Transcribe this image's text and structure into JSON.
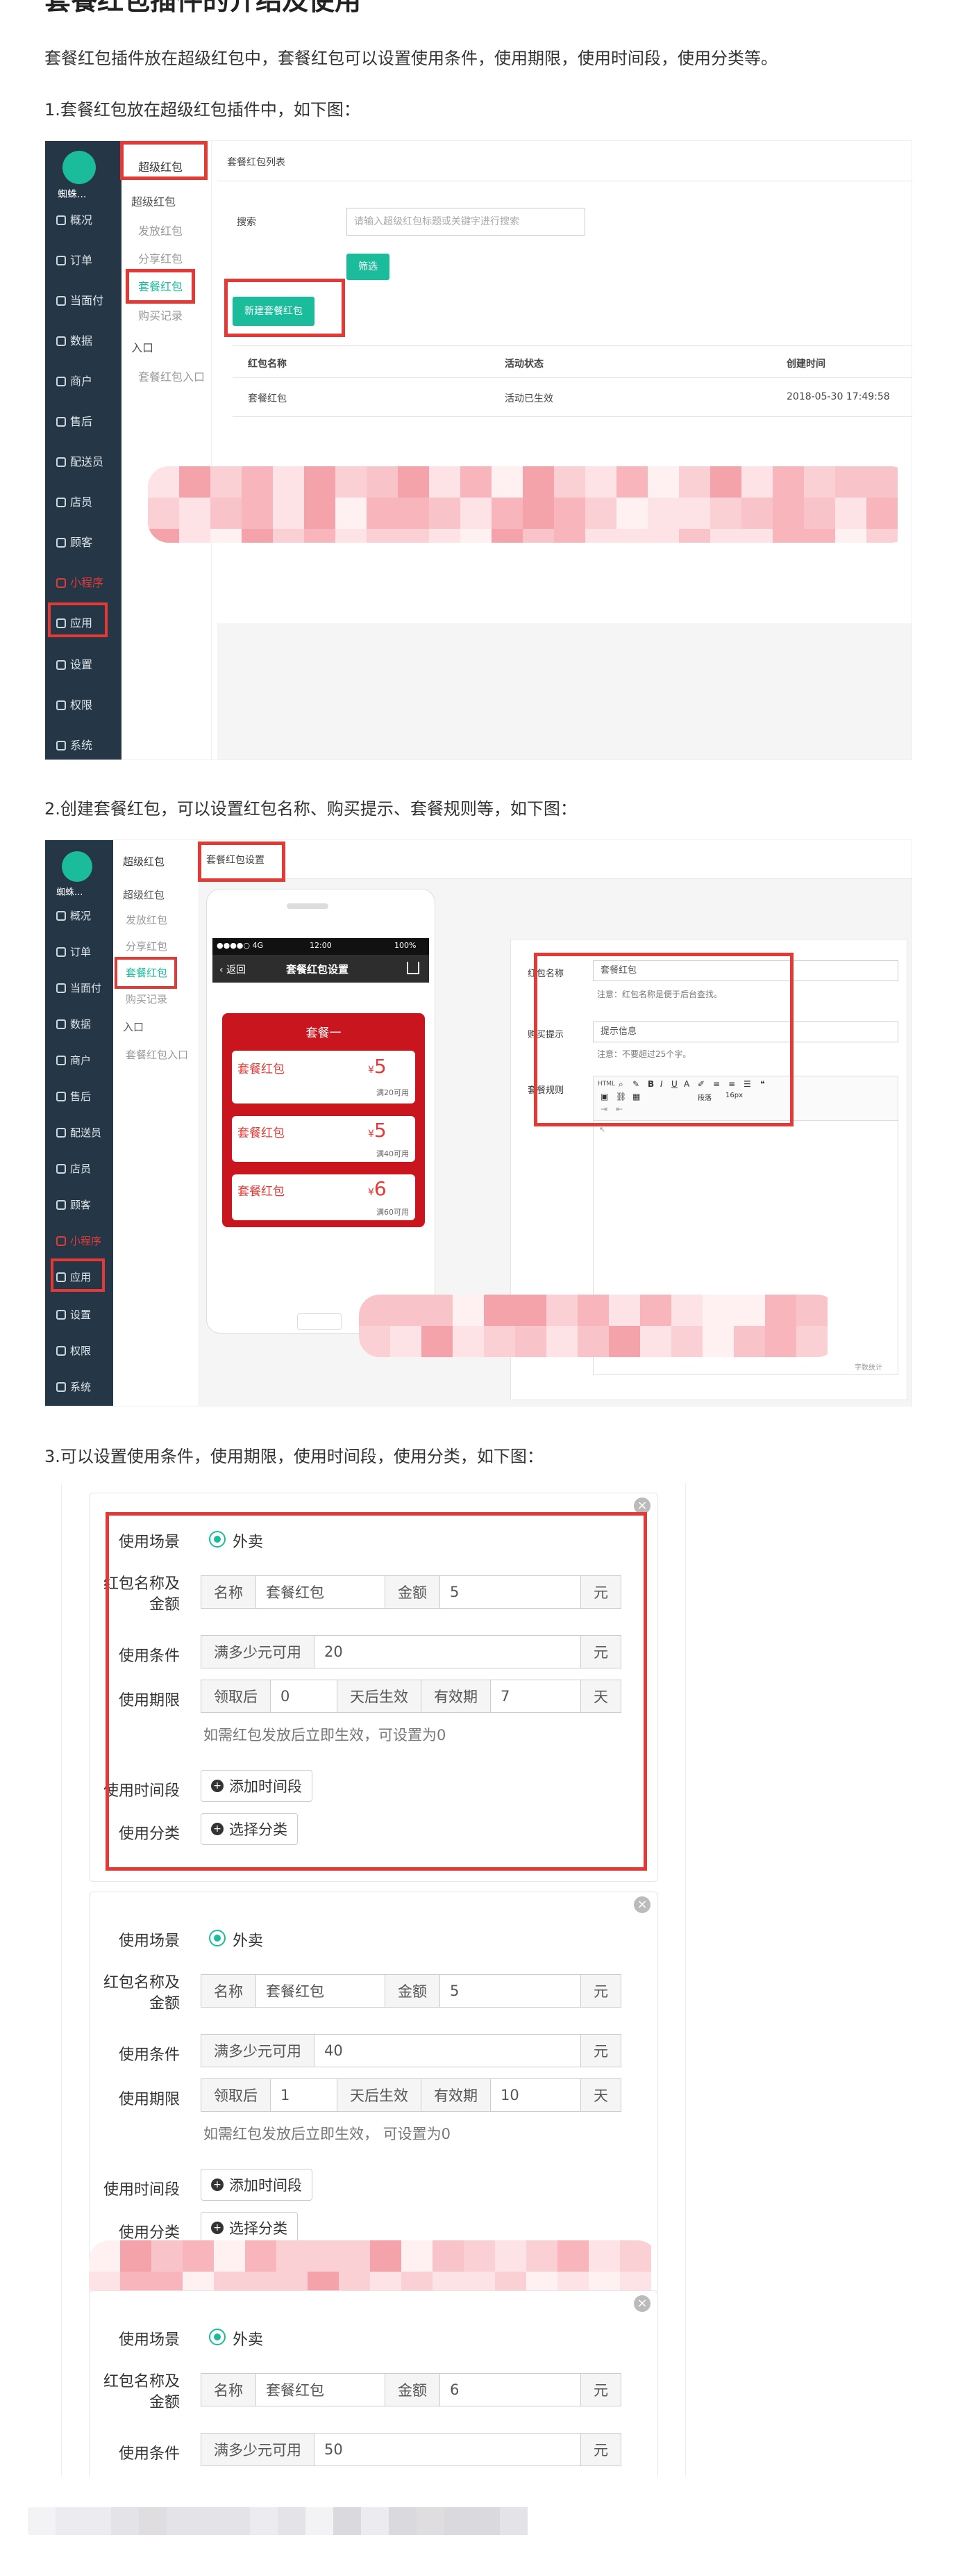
{
  "article": {
    "title": "套餐红包插件的介绍及使用",
    "intro": "套餐红包插件放在超级红包中，套餐红包可以设置使用条件，使用期限，使用时间段，使用分类等。",
    "step1": "1.套餐红包放在超级红包插件中，如下图：",
    "step2": "2.创建套餐红包，可以设置红包名称、购买提示、套餐规则等，如下图：",
    "step3": "3.可以设置使用条件，使用期限，使用时间段，使用分类，如下图："
  },
  "sidebar": {
    "store": "蜘蛛...",
    "items": [
      "概况",
      "订单",
      "当面付",
      "数据",
      "商户",
      "售后",
      "配送员",
      "店员",
      "顾客",
      "小程序",
      "应用",
      "设置",
      "权限",
      "系统"
    ]
  },
  "shot1": {
    "submenu": {
      "title": "超级红包",
      "group": "超级红包",
      "items": [
        "发放红包",
        "分享红包",
        "套餐红包",
        "购买记录"
      ],
      "group2": "入口",
      "entry": "套餐红包入口"
    },
    "header": "套餐红包列表",
    "search_label": "搜索",
    "search_placeholder": "请输入超级红包标题或关键字进行搜索",
    "filter_btn": "筛选",
    "new_btn": "新建套餐红包",
    "table": {
      "headers": [
        "红包名称",
        "活动状态",
        "创建时间"
      ],
      "row": [
        "套餐红包",
        "活动已生效",
        "2018-05-30 17:49:58"
      ]
    }
  },
  "shot2": {
    "header": "套餐红包设置",
    "submenu": {
      "title": "超级红包",
      "group": "超级红包",
      "items": [
        "发放红包",
        "分享红包",
        "套餐红包",
        "购买记录"
      ],
      "group2": "入口",
      "entry": "套餐红包入口"
    },
    "phone": {
      "status_left": "●●●●○ 4G",
      "status_time": "12:00",
      "status_right": "100%",
      "back": "返回",
      "title": "套餐红包设置",
      "package": "套餐一",
      "coupons": [
        {
          "name": "套餐红包",
          "amount": "5",
          "cond": "满20可用"
        },
        {
          "name": "套餐红包",
          "amount": "5",
          "cond": "满40可用"
        },
        {
          "name": "套餐红包",
          "amount": "6",
          "cond": "满60可用"
        }
      ]
    },
    "form": {
      "name_label": "红包名称",
      "name_value": "套餐红包",
      "name_note": "注意：红包名称是便于后台查找。",
      "tip_label": "购买提示",
      "tip_value": "提示信息",
      "tip_note": "注意：不要超过25个字。",
      "rule_label": "套餐规则",
      "count": "字数统计"
    },
    "editor": {
      "src": "HTML",
      "para": "段落",
      "size": "16px"
    }
  },
  "shot3": {
    "cards": [
      {
        "scene_label": "使用场景",
        "scene_value": "外卖",
        "name_label": [
          "红包名称及",
          "金额"
        ],
        "name_ad": "名称",
        "name_value": "套餐红包",
        "amount_ad": "金额",
        "amount_value": "5",
        "unit_yuan": "元",
        "cond_label": "使用条件",
        "cond_ad": "满多少元可用",
        "cond_value": "20",
        "period_label": "使用期限",
        "period_ad1": "领取后",
        "period_value1": "0",
        "period_ad2": "天后生效",
        "period_ad3": "有效期",
        "period_value2": "7",
        "period_unit": "天",
        "hint": "如需红包发放后立即生效，可设置为0",
        "time_label": "使用时间段",
        "time_btn": "添加时间段",
        "cat_label": "使用分类",
        "cat_btn": "选择分类"
      },
      {
        "scene_label": "使用场景",
        "scene_value": "外卖",
        "name_label": [
          "红包名称及",
          "金额"
        ],
        "name_ad": "名称",
        "name_value": "套餐红包",
        "amount_ad": "金额",
        "amount_value": "5",
        "unit_yuan": "元",
        "cond_label": "使用条件",
        "cond_ad": "满多少元可用",
        "cond_value": "40",
        "period_label": "使用期限",
        "period_ad1": "领取后",
        "period_value1": "1",
        "period_ad2": "天后生效",
        "period_ad3": "有效期",
        "period_value2": "10",
        "period_unit": "天",
        "hint": "如需红包发放后立即生效， 可设置为0",
        "time_label": "使用时间段",
        "time_btn": "添加时间段",
        "cat_label": "使用分类",
        "cat_btn": "选择分类"
      },
      {
        "scene_label": "使用场景",
        "scene_value": "外卖",
        "name_label": [
          "红包名称及",
          "金额"
        ],
        "name_ad": "名称",
        "name_value": "套餐红包",
        "amount_ad": "金额",
        "amount_value": "6",
        "unit_yuan": "元",
        "cond_label": "使用条件",
        "cond_ad": "满多少元可用",
        "cond_value": "50"
      }
    ],
    "close": "×"
  },
  "colors": {
    "accent": "#1abc9c",
    "highlight": "#e53935",
    "sidebar": "#253746",
    "coupon": "#c9151e"
  }
}
